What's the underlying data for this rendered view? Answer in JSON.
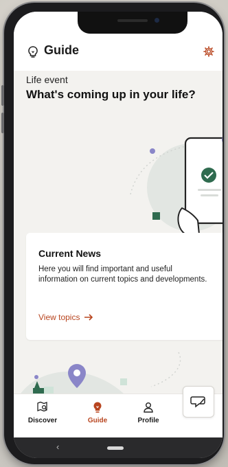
{
  "app": {
    "title": "Guide",
    "icons": {
      "header": "lightbulb-icon",
      "settings": "gear-icon"
    },
    "accent": "#b8451f"
  },
  "section": {
    "overline": "Life event",
    "heading": "What's coming up in your life?"
  },
  "card": {
    "title": "Current News",
    "body": "Here you will find important and useful information on current topics and developments.",
    "link": "View topics"
  },
  "tabs": [
    {
      "label": "Discover",
      "icon": "map-search-icon",
      "active": false
    },
    {
      "label": "Guide",
      "icon": "lightbulb-icon",
      "active": true
    },
    {
      "label": "Profile",
      "icon": "person-icon",
      "active": false
    }
  ],
  "system_nav": {
    "back_glyph": "‹"
  },
  "colors": {
    "background": "#f3f2ef",
    "illustration_green": "#2f6b4f",
    "illustration_purple": "#8a86c8"
  }
}
